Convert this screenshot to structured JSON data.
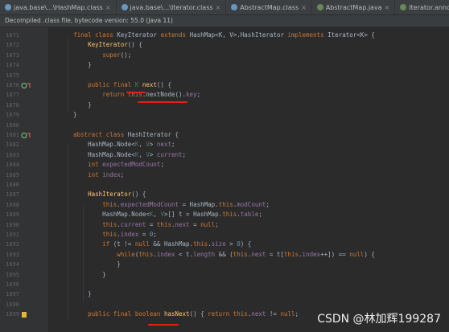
{
  "tabs": [
    {
      "label": "java.base\\...\\HashMap.class",
      "icon_color": "#6897bb",
      "active": false
    },
    {
      "label": "java.base\\...\\Iterator.class",
      "icon_color": "#6897bb",
      "active": false
    },
    {
      "label": "AbstractMap.class",
      "icon_color": "#6897bb",
      "active": false
    },
    {
      "label": "AbstractMap.java",
      "icon_color": "#6a8759",
      "active": false
    },
    {
      "label": "Iterator.annotated.java",
      "icon_color": "#6a8759",
      "active": false
    },
    {
      "label": "Abstra",
      "icon_color": "#6a8759",
      "active": false
    }
  ],
  "banner": "Decompiled .class file, bytecode version: 55.0 (Java 11)",
  "lines": [
    {
      "n": "1871",
      "segs": [
        [
          "    ",
          ""
        ],
        [
          "final class ",
          "kw"
        ],
        [
          "KeyIterator ",
          ""
        ],
        [
          "extends ",
          "kw"
        ],
        [
          "HashMap<",
          ""
        ],
        [
          "K",
          ""
        ],
        [
          ", ",
          ""
        ],
        [
          "V",
          ""
        ],
        [
          ">.",
          ""
        ],
        [
          "HashIterator ",
          ""
        ],
        [
          "implements ",
          "kw"
        ],
        [
          "Iterator<",
          ""
        ],
        [
          "K",
          ""
        ],
        [
          "> {",
          ""
        ]
      ]
    },
    {
      "n": "1872",
      "segs": [
        [
          "        ",
          ""
        ],
        [
          "KeyIterator",
          "fn"
        ],
        [
          "() {",
          ""
        ]
      ]
    },
    {
      "n": "1873",
      "segs": [
        [
          "            ",
          ""
        ],
        [
          "super",
          "kw"
        ],
        [
          "();",
          ""
        ]
      ]
    },
    {
      "n": "1874",
      "segs": [
        [
          "        }",
          ""
        ]
      ]
    },
    {
      "n": "1875",
      "segs": [
        [
          "",
          ""
        ]
      ]
    },
    {
      "n": "1876",
      "mark": "o!",
      "segs": [
        [
          "        ",
          ""
        ],
        [
          "public final ",
          "kw"
        ],
        [
          "K ",
          "gen"
        ],
        [
          "next",
          "fn"
        ],
        [
          "() {",
          ""
        ]
      ]
    },
    {
      "n": "1877",
      "segs": [
        [
          "            ",
          ""
        ],
        [
          "return this",
          "kw"
        ],
        [
          ".nextNode().",
          ""
        ],
        [
          "key",
          "fld"
        ],
        [
          ";",
          ""
        ]
      ]
    },
    {
      "n": "1878",
      "segs": [
        [
          "        }",
          ""
        ]
      ]
    },
    {
      "n": "1879",
      "segs": [
        [
          "    }",
          ""
        ]
      ]
    },
    {
      "n": "1880",
      "segs": [
        [
          "",
          ""
        ]
      ]
    },
    {
      "n": "1881",
      "mark": "oi",
      "segs": [
        [
          "    ",
          ""
        ],
        [
          "abstract class ",
          "kw"
        ],
        [
          "HashIterator {",
          ""
        ]
      ]
    },
    {
      "n": "1882",
      "segs": [
        [
          "        HashMap.Node<",
          ""
        ],
        [
          "K",
          "gen"
        ],
        [
          ", ",
          ""
        ],
        [
          "V",
          "gen"
        ],
        [
          "> ",
          ""
        ],
        [
          "next",
          "fld"
        ],
        [
          ";",
          ""
        ]
      ]
    },
    {
      "n": "1883",
      "segs": [
        [
          "        HashMap.Node<",
          ""
        ],
        [
          "K",
          "gen"
        ],
        [
          ", ",
          ""
        ],
        [
          "V",
          "gen"
        ],
        [
          "> ",
          ""
        ],
        [
          "current",
          "fld"
        ],
        [
          ";",
          ""
        ]
      ]
    },
    {
      "n": "1884",
      "segs": [
        [
          "        ",
          ""
        ],
        [
          "int ",
          "kw"
        ],
        [
          "expectedModCount",
          "fld"
        ],
        [
          ";",
          ""
        ]
      ]
    },
    {
      "n": "1885",
      "segs": [
        [
          "        ",
          ""
        ],
        [
          "int ",
          "kw"
        ],
        [
          "index",
          "fld"
        ],
        [
          ";",
          ""
        ]
      ]
    },
    {
      "n": "1886",
      "segs": [
        [
          "",
          ""
        ]
      ]
    },
    {
      "n": "1887",
      "segs": [
        [
          "        ",
          ""
        ],
        [
          "HashIterator",
          "fn"
        ],
        [
          "() {",
          ""
        ]
      ]
    },
    {
      "n": "1888",
      "segs": [
        [
          "            ",
          ""
        ],
        [
          "this",
          "kw"
        ],
        [
          ".",
          ""
        ],
        [
          "expectedModCount",
          "fld"
        ],
        [
          " = HashMap.",
          ""
        ],
        [
          "this",
          "kw"
        ],
        [
          ".",
          ""
        ],
        [
          "modCount",
          "fld"
        ],
        [
          ";",
          ""
        ]
      ]
    },
    {
      "n": "1889",
      "segs": [
        [
          "            HashMap.Node<",
          ""
        ],
        [
          "K",
          "gen"
        ],
        [
          ", ",
          ""
        ],
        [
          "V",
          "gen"
        ],
        [
          ">[] t = HashMap.",
          ""
        ],
        [
          "this",
          "kw"
        ],
        [
          ".",
          ""
        ],
        [
          "table",
          "fld"
        ],
        [
          ";",
          ""
        ]
      ]
    },
    {
      "n": "1890",
      "segs": [
        [
          "            ",
          ""
        ],
        [
          "this",
          "kw"
        ],
        [
          ".",
          ""
        ],
        [
          "current",
          "fld"
        ],
        [
          " = ",
          ""
        ],
        [
          "this",
          "kw"
        ],
        [
          ".",
          ""
        ],
        [
          "next",
          "fld"
        ],
        [
          " = ",
          ""
        ],
        [
          "null",
          "kw"
        ],
        [
          ";",
          ""
        ]
      ]
    },
    {
      "n": "1891",
      "segs": [
        [
          "            ",
          ""
        ],
        [
          "this",
          "kw"
        ],
        [
          ".",
          ""
        ],
        [
          "index",
          "fld"
        ],
        [
          " = ",
          ""
        ],
        [
          "0",
          "num"
        ],
        [
          ";",
          ""
        ]
      ]
    },
    {
      "n": "1892",
      "segs": [
        [
          "            ",
          ""
        ],
        [
          "if ",
          "kw"
        ],
        [
          "(t != ",
          ""
        ],
        [
          "null ",
          "kw"
        ],
        [
          "&& HashMap.",
          ""
        ],
        [
          "this",
          "kw"
        ],
        [
          ".",
          ""
        ],
        [
          "size",
          "fld"
        ],
        [
          " > ",
          ""
        ],
        [
          "0",
          "num"
        ],
        [
          ") {",
          ""
        ]
      ]
    },
    {
      "n": "1893",
      "segs": [
        [
          "                ",
          ""
        ],
        [
          "while",
          "kw"
        ],
        [
          "(",
          ""
        ],
        [
          "this",
          "kw"
        ],
        [
          ".",
          ""
        ],
        [
          "index",
          "fld"
        ],
        [
          " < t.",
          ""
        ],
        [
          "length ",
          "fld"
        ],
        [
          "&& (",
          ""
        ],
        [
          "this",
          "kw"
        ],
        [
          ".",
          ""
        ],
        [
          "next",
          "fld"
        ],
        [
          " = t[",
          ""
        ],
        [
          "this",
          "kw"
        ],
        [
          ".",
          ""
        ],
        [
          "index",
          "fld"
        ],
        [
          "++]) == ",
          ""
        ],
        [
          "null",
          "kw"
        ],
        [
          ") {",
          ""
        ]
      ]
    },
    {
      "n": "1894",
      "segs": [
        [
          "                }",
          ""
        ]
      ]
    },
    {
      "n": "1895",
      "segs": [
        [
          "            }",
          ""
        ]
      ]
    },
    {
      "n": "1896",
      "segs": [
        [
          "",
          ""
        ]
      ]
    },
    {
      "n": "1897",
      "segs": [
        [
          "        }",
          ""
        ]
      ]
    },
    {
      "n": "1898",
      "segs": [
        [
          "",
          ""
        ]
      ]
    },
    {
      "n": "1899",
      "mark": "!",
      "segs": [
        [
          "        ",
          ""
        ],
        [
          "public final boolean ",
          "kw"
        ],
        [
          "hasNext",
          "fn"
        ],
        [
          "() { ",
          ""
        ],
        [
          "return this",
          "kw"
        ],
        [
          ".",
          ""
        ],
        [
          "next",
          "fld"
        ],
        [
          " != ",
          ""
        ],
        [
          "null",
          "kw"
        ],
        [
          ";",
          ""
        ]
      ]
    }
  ],
  "watermark": "CSDN @林加辉199287",
  "colors": {
    "annotation_underline": "#e0201b",
    "keyword": "#cc7832",
    "method": "#ffc66d",
    "field": "#9876aa",
    "number": "#6897bb"
  }
}
